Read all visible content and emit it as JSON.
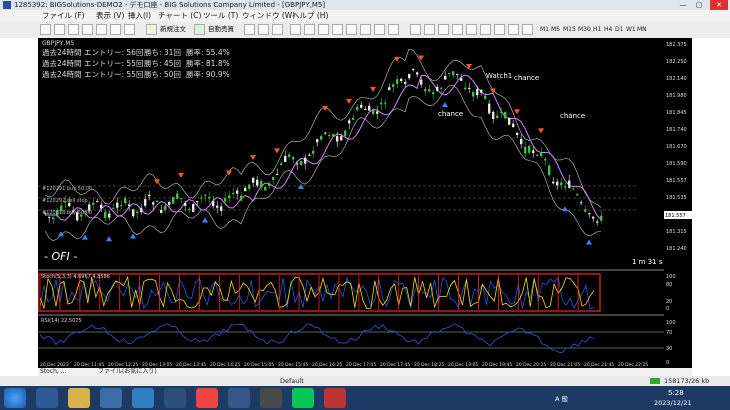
{
  "window": {
    "title": "1285392: BIGSolutions-DEMO2 - デモ口座 - BIG Solutions Company Limited - [GBPJPY,M5]",
    "minimize": "—",
    "maximize": "▢",
    "close": "✕"
  },
  "menu": [
    "ファイル (F)",
    "表示 (V)",
    "挿入(I)",
    "チャート (C)",
    "ツール (T)",
    "ウィンドウ (W)",
    "ヘルプ (H)"
  ],
  "toolbar": {
    "new_order": "新規注文",
    "auto_trade": "自動売買",
    "timeframes": [
      "M1",
      "M5",
      "M15",
      "M30",
      "H1",
      "H4",
      "D1",
      "W1",
      "MN"
    ]
  },
  "chart": {
    "symbol": "GBPJPY,M5",
    "stats": [
      {
        "period": "過去24時間",
        "entries": "エントリー: 56回",
        "wins": "勝ち: 31回",
        "rate": "勝率: 55.4%"
      },
      {
        "period": "過去24時間",
        "entries": "エントリー: 55回",
        "wins": "勝ち: 45回",
        "rate": "勝率: 81.8%"
      },
      {
        "period": "過去24時間",
        "entries": "エントリー: 55回",
        "wins": "勝ち: 50回",
        "rate": "勝率: 90.9%"
      }
    ],
    "labels": {
      "chance1": "chance",
      "chance2": "chance",
      "chance3": "chance",
      "watch": "Watch1",
      "brand": "- OFI -",
      "timer": "1 m 31 s"
    },
    "order_lines": [
      "#120291 buy 50.00",
      "#120292 sell stop",
      "#120318 buy 50.00"
    ],
    "price_axis": [
      "182.375",
      "182.250",
      "182.140",
      "181.980",
      "181.845",
      "181.740",
      "181.670",
      "181.590",
      "181.557",
      "181.535",
      "181.440",
      "181.315",
      "181.240"
    ],
    "current_price": "181.557",
    "stoch": {
      "label": "Stoch(5,3,3) 4.6967 4.3586",
      "levels": [
        "100",
        "80",
        "20",
        "0"
      ]
    },
    "rsi": {
      "label": "RSI(14) 22.5075",
      "levels": [
        "100",
        "70",
        "30",
        "0"
      ]
    },
    "time_axis": [
      "20 Dec 2023",
      "20 Dec 11:45",
      "20 Dec 12:25",
      "20 Dec 13:05",
      "20 Dec 13:45",
      "20 Dec 14:25",
      "20 Dec 15:05",
      "20 Dec 15:45",
      "20 Dec 16:25",
      "20 Dec 17:05",
      "20 Dec 17:45",
      "20 Dec 18:25",
      "20 Dec 19:05",
      "20 Dec 19:45",
      "20 Dec 20:25",
      "20 Dec 21:05",
      "20 Dec 21:45",
      "20 Dec 22:25"
    ],
    "colors": {
      "up": "#44c044",
      "down": "#e8e8e8",
      "band": "#c8c8c8",
      "ma": "#cc88ee",
      "sell": "#ff5522",
      "buy": "#3388ff",
      "stoch_main": "#ffd700",
      "stoch_signal": "#2266ff",
      "stoch_box": "#ff2222",
      "rsi": "#3355dd"
    }
  },
  "tabs": [
    "Stoch, ...",
    "ファイル(お気に入り)"
  ],
  "status": {
    "profile": "Default",
    "traffic": "158173/26 kb"
  },
  "taskbar": {
    "lang": "A 般",
    "time": "5:28",
    "date": "2023/12/21"
  }
}
